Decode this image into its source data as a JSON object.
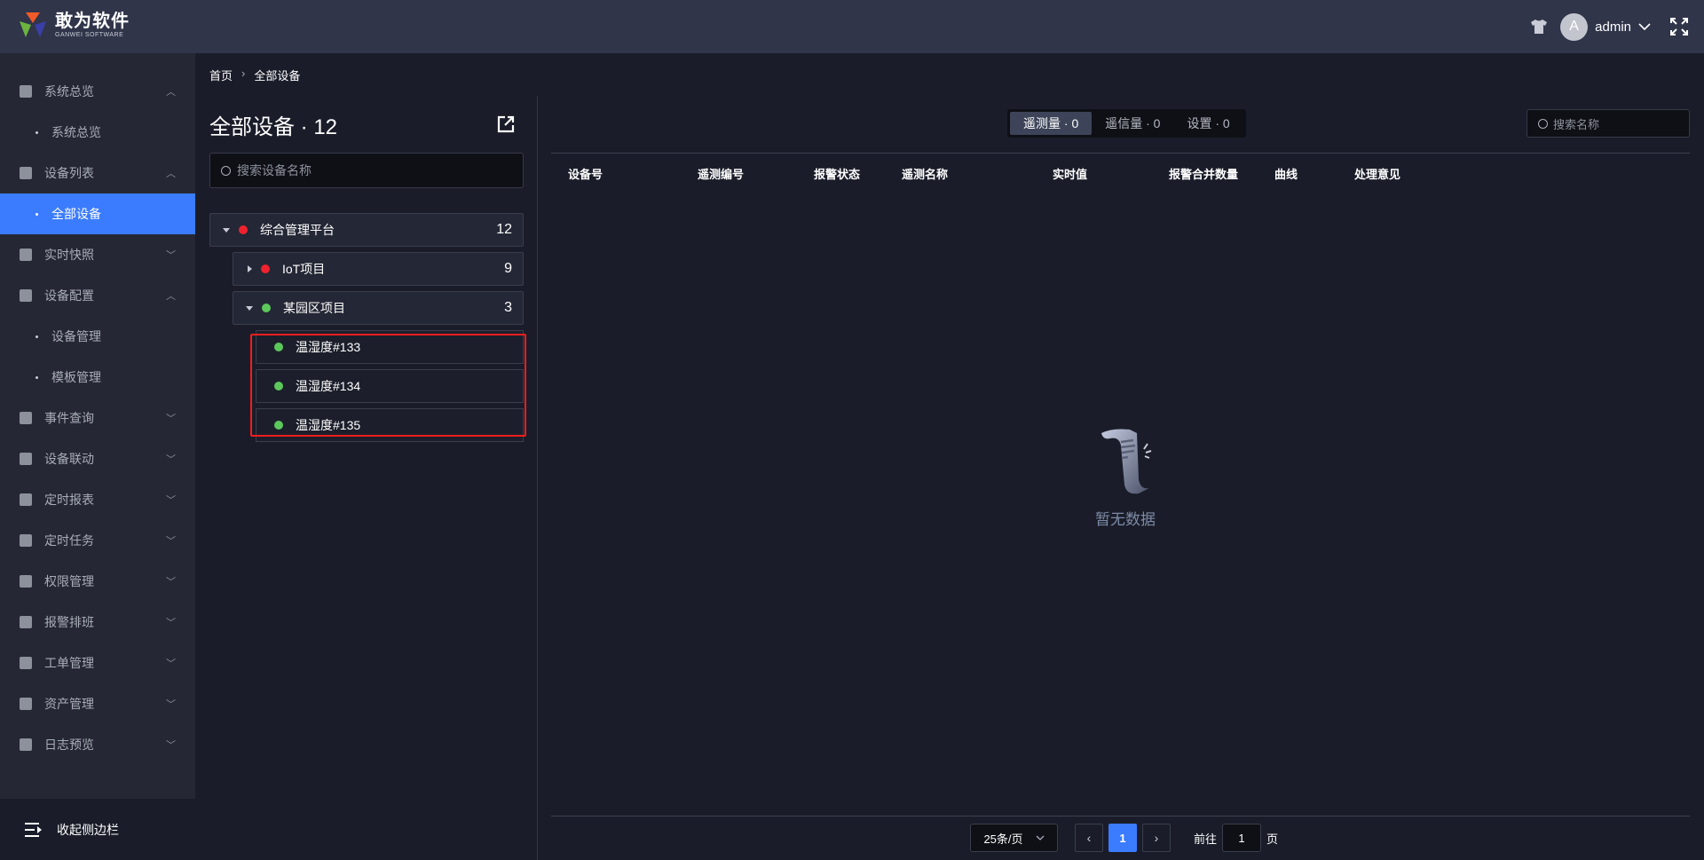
{
  "header": {
    "logo_cn": "敢为软件",
    "logo_en": "GANWEI SOFTWARE",
    "avatar_letter": "A",
    "username": "admin"
  },
  "sidebar": {
    "items": [
      {
        "label": "系统总览",
        "type": "group",
        "expanded": true
      },
      {
        "label": "系统总览",
        "type": "sub"
      },
      {
        "label": "设备列表",
        "type": "group",
        "expanded": true
      },
      {
        "label": "全部设备",
        "type": "sub",
        "active": true
      },
      {
        "label": "实时快照",
        "type": "group"
      },
      {
        "label": "设备配置",
        "type": "group",
        "expanded": true
      },
      {
        "label": "设备管理",
        "type": "sub"
      },
      {
        "label": "模板管理",
        "type": "sub"
      },
      {
        "label": "事件查询",
        "type": "group"
      },
      {
        "label": "设备联动",
        "type": "group"
      },
      {
        "label": "定时报表",
        "type": "group"
      },
      {
        "label": "定时任务",
        "type": "group"
      },
      {
        "label": "权限管理",
        "type": "group"
      },
      {
        "label": "报警排班",
        "type": "group"
      },
      {
        "label": "工单管理",
        "type": "group"
      },
      {
        "label": "资产管理",
        "type": "group"
      },
      {
        "label": "日志预览",
        "type": "group"
      }
    ],
    "collapse_label": "收起侧边栏"
  },
  "breadcrumb": {
    "home": "首页",
    "current": "全部设备"
  },
  "left_panel": {
    "title": "全部设备 · 12",
    "search_placeholder": "搜索设备名称",
    "tree": [
      {
        "label": "综合管理平台",
        "count": "12",
        "status": "alarm"
      },
      {
        "label": "IoT项目",
        "count": "9",
        "status": "alarm"
      },
      {
        "label": "某园区项目",
        "count": "3",
        "status": "ok"
      }
    ],
    "devices": [
      {
        "label": "温湿度#133"
      },
      {
        "label": "温湿度#134"
      },
      {
        "label": "温湿度#135"
      }
    ]
  },
  "main": {
    "tabs": [
      {
        "label": "遥测量 · 0",
        "active": true
      },
      {
        "label": "遥信量 · 0"
      },
      {
        "label": "设置 · 0"
      }
    ],
    "search_placeholder": "搜索名称",
    "columns": [
      "设备号",
      "遥测编号",
      "报警状态",
      "遥测名称",
      "实时值",
      "报警合并数量",
      "曲线",
      "处理意见"
    ],
    "empty_text": "暂无数据"
  },
  "pagination": {
    "page_size": "25条/页",
    "current_page": "1",
    "goto_label": "前往",
    "goto_value": "1",
    "page_suffix": "页"
  },
  "colors": {
    "accent": "#3b7cff",
    "alarm": "#f0212e",
    "ok": "#5cc85c",
    "highlight": "#f01e1e"
  }
}
